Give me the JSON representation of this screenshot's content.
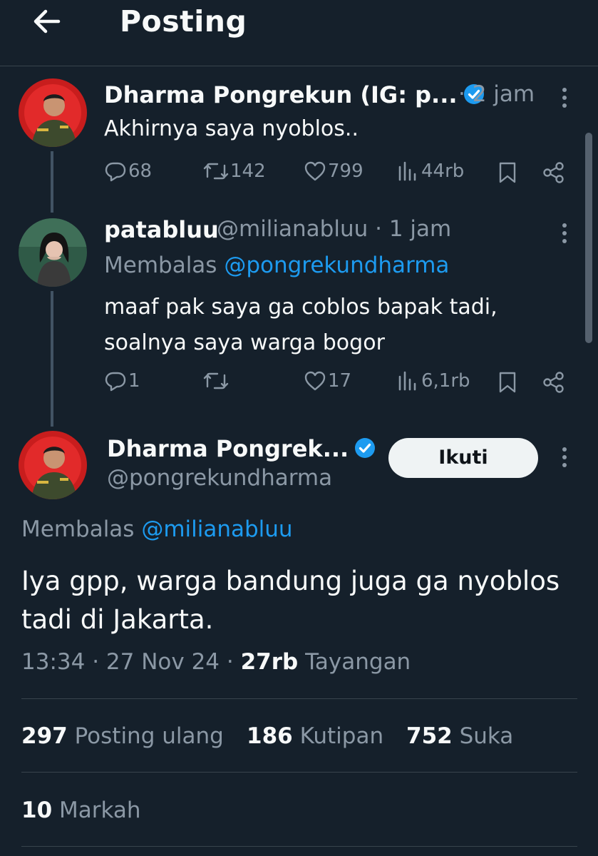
{
  "header": {
    "title": "Posting"
  },
  "posts": [
    {
      "name": "Dharma Pongrekun (IG: p...",
      "separator": "·",
      "time": "2 jam",
      "text": "Akhirnya saya nyoblos..",
      "actions": {
        "replies": "68",
        "reposts": "142",
        "likes": "799",
        "views": "44rb"
      }
    },
    {
      "name": "patabluu",
      "handle": "@milianabluu",
      "separator": "·",
      "time": "1 jam",
      "replying_label": "Membalas",
      "replying_to": "@pongrekundharma",
      "text_lines": [
        "maaf pak saya ga coblos bapak tadi,",
        "soalnya saya warga bogor"
      ],
      "actions": {
        "replies": "1",
        "reposts": "",
        "likes": "17",
        "views": "6,1rb"
      }
    }
  ],
  "main_post": {
    "name": "Dharma Pongrek...",
    "handle": "@pongrekundharma",
    "follow_label": "Ikuti",
    "replying_label": "Membalas",
    "replying_to": "@milianabluu",
    "text_lines": [
      "Iya gpp, warga bandung juga ga nyoblos",
      "tadi di Jakarta."
    ],
    "time": "13:34",
    "date": "27 Nov 24",
    "separator": "·",
    "views_count": "27rb",
    "views_label": "Tayangan",
    "stats": {
      "reposts_count": "297",
      "reposts_label": "Posting ulang",
      "quotes_count": "186",
      "quotes_label": "Kutipan",
      "likes_count": "752",
      "likes_label": "Suka",
      "bookmarks_count": "10",
      "bookmarks_label": "Markah"
    }
  },
  "colors": {
    "background": "#15202b",
    "text": "#f7f9f9",
    "muted": "#8b98a5",
    "link": "#1d9bf0",
    "verified": "#1d9bf0",
    "divider": "#38444d",
    "button_bg": "#eff3f4"
  },
  "icons": [
    "back-arrow-icon",
    "verified-badge-icon",
    "more-icon",
    "reply-icon",
    "repost-icon",
    "like-icon",
    "views-icon",
    "bookmark-icon",
    "share-icon"
  ]
}
